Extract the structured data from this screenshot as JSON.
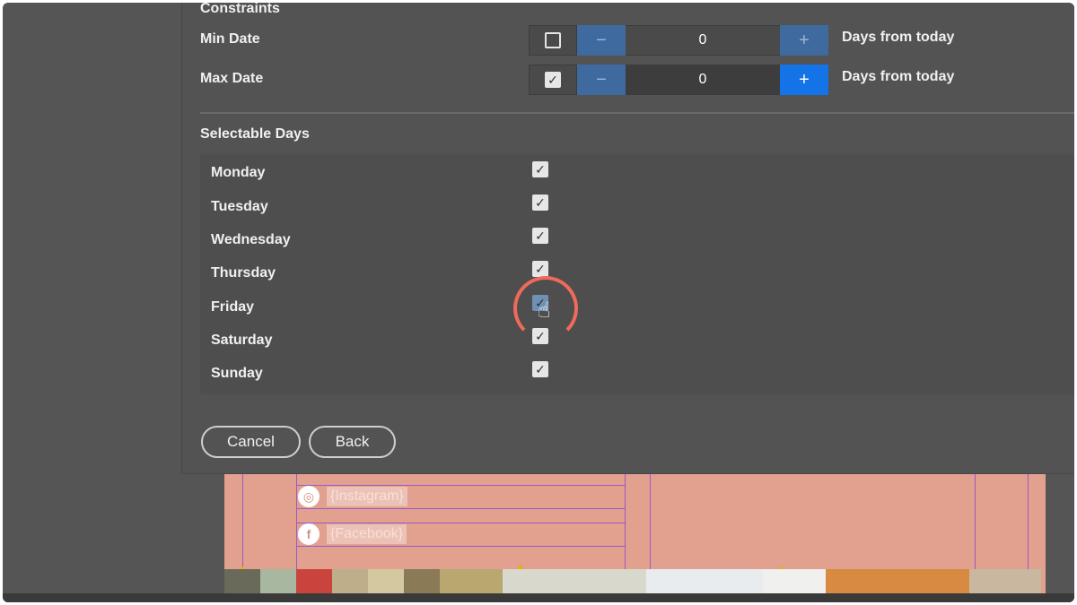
{
  "constraints": {
    "title": "Constraints",
    "min_date": {
      "label": "Min Date",
      "checked": false,
      "value": "0",
      "suffix": "Days from today"
    },
    "max_date": {
      "label": "Max Date",
      "checked": true,
      "value": "0",
      "suffix": "Days from today"
    },
    "minus_symbol": "−",
    "plus_symbol": "+"
  },
  "selectable_days": {
    "title": "Selectable Days",
    "days": [
      {
        "label": "Monday",
        "checked": true
      },
      {
        "label": "Tuesday",
        "checked": true
      },
      {
        "label": "Wednesday",
        "checked": true
      },
      {
        "label": "Thursday",
        "checked": true
      },
      {
        "label": "Friday",
        "checked": true
      },
      {
        "label": "Saturday",
        "checked": true
      },
      {
        "label": "Sunday",
        "checked": true
      }
    ]
  },
  "buttons": {
    "cancel": "Cancel",
    "back": "Back"
  },
  "background_canvas": {
    "instagram_placeholder": "{Instagram}",
    "facebook_placeholder": "{Facebook}"
  },
  "colors": {
    "accent": "#1473e6",
    "dialog_bg": "#535353",
    "canvas_bg": "#e2a08f",
    "click_ring": "#f06a5a"
  },
  "icons": {
    "checkmark": "check-icon",
    "instagram": "instagram-icon",
    "facebook": "facebook-icon",
    "warning": "warning-icon",
    "cursor": "hand-cursor-icon"
  }
}
